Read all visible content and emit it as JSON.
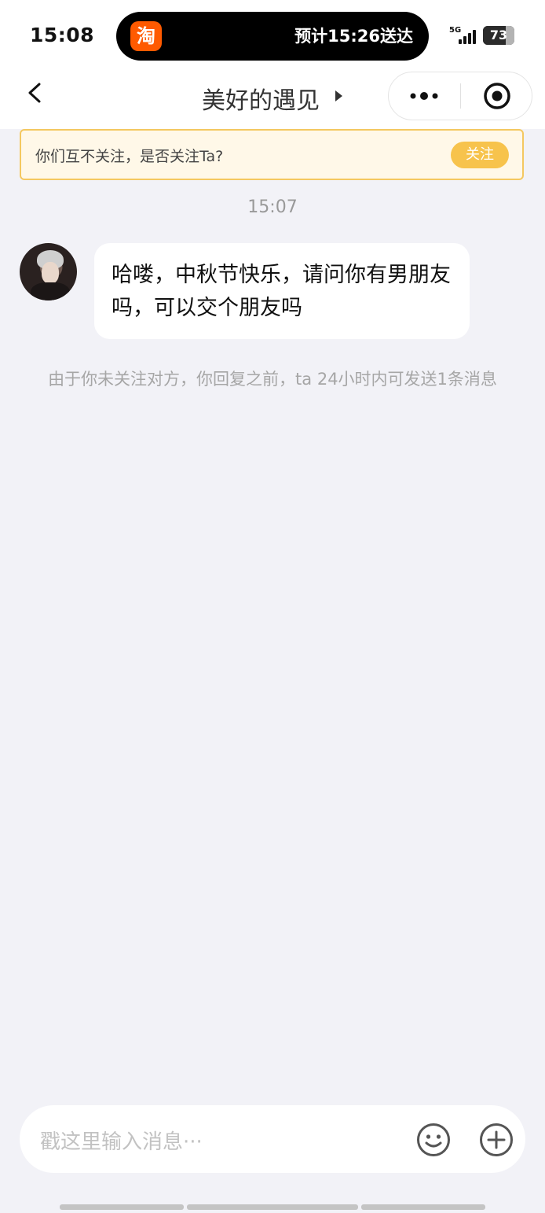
{
  "status_bar": {
    "time": "15:08",
    "island_app_icon": "淘",
    "delivery_text": "预计15:26送达",
    "network": "5G",
    "battery_level": "73"
  },
  "nav": {
    "title": "美好的遇见",
    "back_icon": "back-chevron-icon",
    "more_icon": "more-dots-icon",
    "close_icon": "target-close-icon"
  },
  "follow_banner": {
    "text": "你们互不关注，是否关注Ta?",
    "button_label": "关注"
  },
  "chat": {
    "timestamp": "15:07",
    "messages": [
      {
        "sender": "other",
        "text": "哈喽，中秋节快乐，请问你有男朋友吗，可以交个朋友吗"
      }
    ],
    "notice": "由于你未关注对方，你回复之前，ta 24小时内可发送1条消息"
  },
  "input_bar": {
    "placeholder": "戳这里输入消息···",
    "emoji_icon": "smile-emoji-icon",
    "plus_icon": "plus-circle-icon"
  },
  "colors": {
    "accent_yellow": "#f7c34c",
    "banner_bg": "#fff8e8",
    "page_bg": "#f2f2f7",
    "taobao_orange": "#ff5a00"
  }
}
